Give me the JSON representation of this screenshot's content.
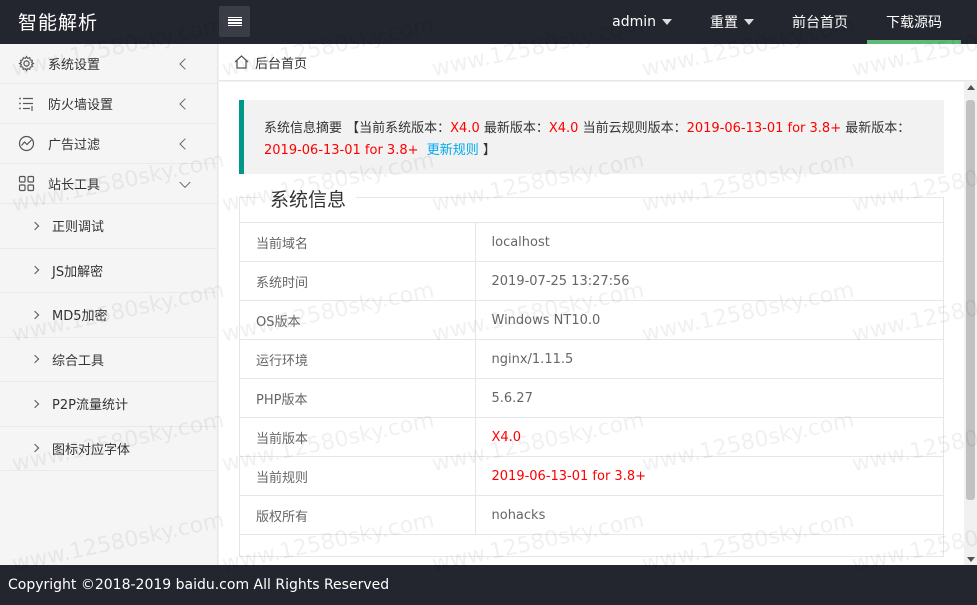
{
  "header": {
    "logo": "智能解析",
    "nav": [
      {
        "label": "admin",
        "has_caret": true
      },
      {
        "label": "重置",
        "has_caret": true
      },
      {
        "label": "前台首页",
        "has_caret": false
      },
      {
        "label": "下载源码",
        "has_caret": false,
        "active": true
      }
    ]
  },
  "sidebar": {
    "items": [
      {
        "label": "系统设置",
        "icon": "gear-icon"
      },
      {
        "label": "防火墙设置",
        "icon": "list-icon"
      },
      {
        "label": "广告过滤",
        "icon": "chart-icon"
      },
      {
        "label": "站长工具",
        "icon": "apps-icon",
        "expanded": true
      }
    ],
    "sub_items": [
      {
        "label": "正则调试"
      },
      {
        "label": "JS加解密"
      },
      {
        "label": "MD5加密"
      },
      {
        "label": "综合工具"
      },
      {
        "label": "P2P流量统计"
      },
      {
        "label": "图标对应字体"
      }
    ]
  },
  "breadcrumb": {
    "label": "后台首页"
  },
  "notice": {
    "prefix": "系统信息摘要 【当前系统版本：",
    "current_version": "X4.0",
    "latest_label": " 最新版本：",
    "latest_version": "X4.0",
    "rule_label": " 当前云规则版本：",
    "rule_version": "2019-06-13-01 for 3.8+",
    "latest_rule_label": " 最新版本：",
    "latest_rule_version": "2019-06-13-01 for 3.8+",
    "update_link": "更新规则",
    "suffix": " 】"
  },
  "system_info": {
    "title": "系统信息",
    "rows": [
      {
        "key": "当前域名",
        "value": "localhost",
        "highlight": false
      },
      {
        "key": "系统时间",
        "value": "2019-07-25 13:27:56",
        "highlight": false
      },
      {
        "key": "OS版本",
        "value": "Windows NT10.0",
        "highlight": false
      },
      {
        "key": "运行环境",
        "value": "nginx/1.11.5",
        "highlight": false
      },
      {
        "key": "PHP版本",
        "value": "5.6.27",
        "highlight": false
      },
      {
        "key": "当前版本",
        "value": "X4.0",
        "highlight": true
      },
      {
        "key": "当前规则",
        "value": "2019-06-13-01 for 3.8+",
        "highlight": true
      },
      {
        "key": "版权所有",
        "value": "nohacks",
        "highlight": false
      }
    ]
  },
  "footer": {
    "text": "Copyright ©2018-2019 baidu.com All Rights Reserved"
  },
  "watermark": {
    "text": "www.12580sky.com"
  },
  "colors": {
    "header_bg": "#23262e",
    "accent_green": "#5fb878",
    "notice_border": "#009688",
    "highlight_red": "#ff0000",
    "link_blue": "#01aaed"
  }
}
